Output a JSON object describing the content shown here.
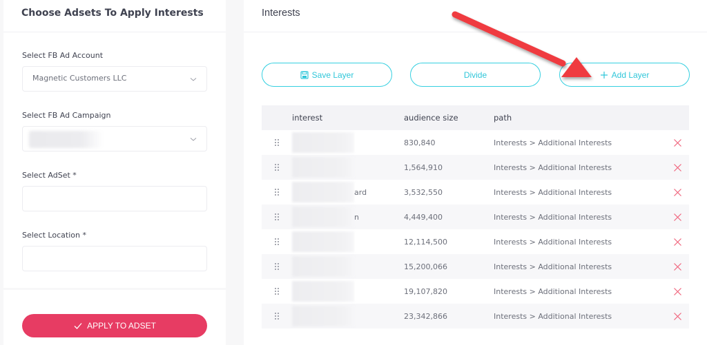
{
  "left_panel": {
    "title": "Choose Adsets To Apply Interests",
    "fields": [
      {
        "label": "Select FB Ad Account",
        "value": "Magnetic Customers LLC",
        "type": "select"
      },
      {
        "label": "Select FB Ad Campaign",
        "value": "",
        "type": "select",
        "blurred": true
      },
      {
        "label": "Select AdSet *",
        "value": "",
        "type": "input"
      },
      {
        "label": "Select Location *",
        "value": "",
        "type": "input"
      }
    ],
    "apply_button": "APPLY TO ADSET"
  },
  "right_panel": {
    "title": "Interests",
    "buttons": {
      "save_layer": "Save Layer",
      "divide": "Divide",
      "add_layer": "Add Layer"
    },
    "table": {
      "columns": [
        "interest",
        "audience size",
        "path"
      ],
      "rows": [
        {
          "interest_visible_tail": "",
          "audience_size": "830,840",
          "path": "Interests > Additional Interests"
        },
        {
          "interest_visible_tail": "",
          "audience_size": "1,564,910",
          "path": "Interests > Additional Interests"
        },
        {
          "interest_visible_tail": "ard",
          "audience_size": "3,532,550",
          "path": "Interests > Additional Interests"
        },
        {
          "interest_visible_tail": "n",
          "audience_size": "4,449,400",
          "path": "Interests > Additional Interests"
        },
        {
          "interest_visible_tail": "",
          "audience_size": "12,114,500",
          "path": "Interests > Additional Interests"
        },
        {
          "interest_visible_tail": "",
          "audience_size": "15,200,066",
          "path": "Interests > Additional Interests"
        },
        {
          "interest_visible_tail": "",
          "audience_size": "19,107,820",
          "path": "Interests > Additional Interests"
        },
        {
          "interest_visible_tail": "",
          "audience_size": "23,342,866",
          "path": "Interests > Additional Interests"
        }
      ]
    }
  },
  "colors": {
    "accent_cyan": "#34cfe0",
    "apply_red": "#e73c63",
    "delete_red": "#f0647c",
    "annotation_arrow": "#ef3b3f"
  },
  "icons": {
    "save": "floppy-disk-icon",
    "add": "plus-icon",
    "apply": "checkmark-icon",
    "row_handle": "drag-handle-icon",
    "row_delete": "close-icon",
    "select": "chevron-down-icon"
  }
}
